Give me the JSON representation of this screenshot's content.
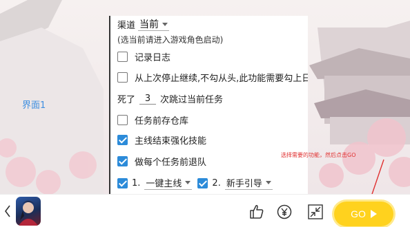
{
  "side_label": "界面1",
  "panel": {
    "channel_label": "渠道",
    "channel_value": "当前",
    "hint": "(选当前请进入游戏角色启动)",
    "options": [
      {
        "label": "记录日志",
        "checked": false
      },
      {
        "label": "从上次停止继续,不勾从头,此功能需要勾上日志",
        "checked": false
      }
    ],
    "death_prefix": "死了",
    "death_count": "3",
    "death_suffix": "次跳过当前任务",
    "options2": [
      {
        "label": "任务前存仓库",
        "checked": false
      },
      {
        "label": "主线结束强化技能",
        "checked": true
      },
      {
        "label": "做每个任务前退队",
        "checked": true
      }
    ],
    "tasks": [
      {
        "index": "1.",
        "value": "一键主线",
        "checked": true
      },
      {
        "index": "2.",
        "value": "新手引导",
        "checked": true
      }
    ]
  },
  "annotation": "选择需要的功能，然后点击GO",
  "bottom": {
    "go_label": "GO",
    "icons": [
      "chevron-left-icon",
      "game-avatar",
      "thumbs-up-icon",
      "yen-icon",
      "shrink-icon",
      "play-icon"
    ]
  },
  "colors": {
    "accent_blue": "#2c8bd9",
    "label_blue": "#3f8fe0",
    "go_yellow": "#ffd21e",
    "annotation_red": "#e03030"
  }
}
